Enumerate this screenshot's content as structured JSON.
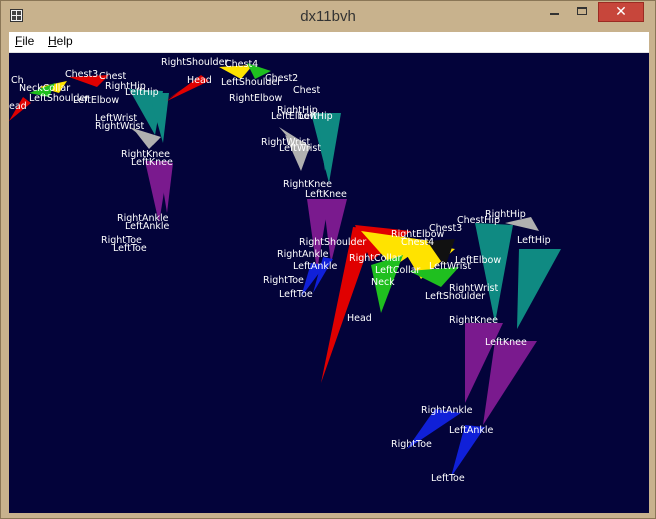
{
  "window": {
    "title": "dx11bvh",
    "close_glyph": "✕"
  },
  "menu": {
    "file": "File",
    "help": "Help"
  },
  "icons": [
    "app-icon",
    "minimize-icon",
    "maximize-icon",
    "close-icon"
  ],
  "colors": {
    "viewport_bg": "#03033a",
    "head": "#e00000",
    "collar": "#ffe300",
    "shoulder": "#1fbf1f",
    "upper_body": "#0f8a82",
    "lower_leg": "#7a1a8e",
    "foot": "#1020d8",
    "hand": "#b0b0b0"
  },
  "scene": {
    "labels": [
      "Ch",
      "Chest3",
      "Chest",
      "NeckCollar",
      "RightHip",
      "LeftHip",
      "LeftElbow",
      "ead",
      "LeftShoulder",
      "LeftWrist",
      "RightWrist",
      "RightKnee",
      "LeftKnee",
      "RightAnkle",
      "LeftAnkle",
      "RightToe",
      "LeftToe",
      "RightShoulder",
      "Head",
      "Chest4",
      "LeftShoulder",
      "Chest2",
      "RightElbow",
      "Chest",
      "RightHip",
      "LeftElbow",
      "LeftHip",
      "RightWrist",
      "LeftWrist",
      "RightKnee",
      "LeftKnee",
      "RightShoulder",
      "RightAnkle",
      "LeftAnkle",
      "RightToe",
      "LeftToe",
      "RightElbow",
      "Chest3",
      "Chest4",
      "ChestHip",
      "RightHip",
      "LeftHip",
      "RightCollar",
      "LeftCollar",
      "LeftWrist",
      "LeftElbow",
      "Neck",
      "RightWrist",
      "LeftShoulder",
      "RightKnee",
      "LeftKnee",
      "Head",
      "RightAnkle",
      "LeftAnkle",
      "RightToe",
      "LeftToe"
    ]
  }
}
